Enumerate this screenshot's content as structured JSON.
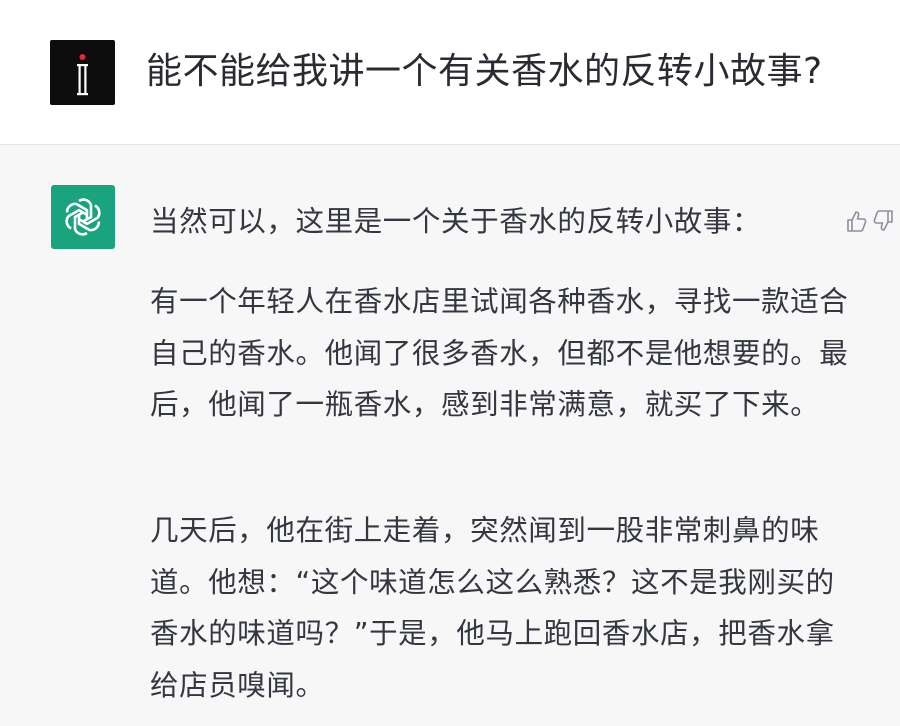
{
  "user": {
    "avatar_icon": "user-logo-icon",
    "message": "能不能给我讲一个有关香水的反转小故事?"
  },
  "assistant": {
    "avatar_icon": "openai-logo-icon",
    "avatar_color": "#19a37f",
    "intro": "当然可以，这里是一个关于香水的反转小故事：",
    "paragraphs": [
      "有一个年轻人在香水店里试闻各种香水，寻找一款适合自己的香水。他闻了很多香水，但都不是他想要的。最后，他闻了一瓶香水，感到非常满意，就买了下来。",
      "几天后，他在街上走着，突然闻到一股非常刺鼻的味道。他想：“这个味道怎么这么熟悉？这不是我刚买的香水的味道吗？”于是，他马上跑回香水店，把香水拿给店员嗅闻。"
    ],
    "feedback": {
      "thumbs_up_icon": "thumbs-up-icon",
      "thumbs_down_icon": "thumbs-down-icon"
    }
  }
}
